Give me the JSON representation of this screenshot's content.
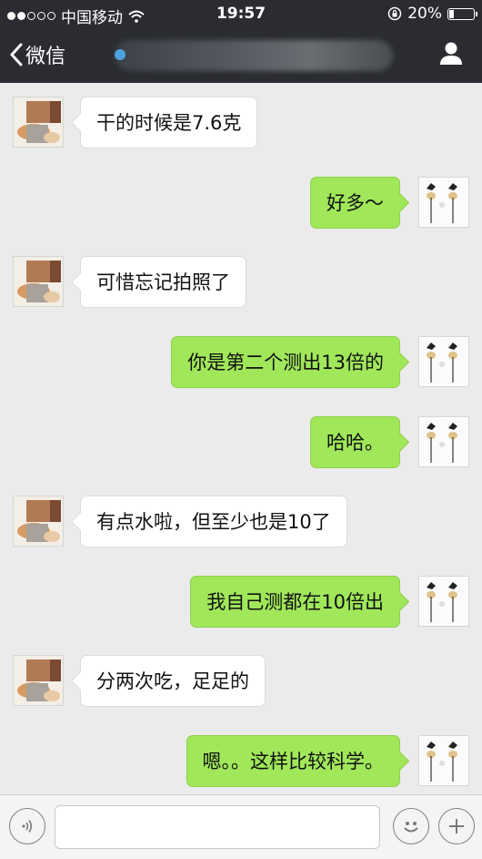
{
  "status": {
    "carrier": "中国移动",
    "time": "19:57",
    "battery": "20%",
    "battery_level": 0.2
  },
  "header": {
    "back_label": "微信",
    "profile_icon": "person-icon"
  },
  "messages": [
    {
      "side": "left",
      "text": "干的时候是7.6克"
    },
    {
      "side": "right",
      "text": "好多～"
    },
    {
      "side": "left",
      "text": "可惜忘记拍照了"
    },
    {
      "side": "right",
      "text": "你是第二个测出13倍的"
    },
    {
      "side": "right",
      "text": "哈哈。"
    },
    {
      "side": "left",
      "text": "有点水啦，但至少也是10了"
    },
    {
      "side": "right",
      "text": "我自己测都在10倍出"
    },
    {
      "side": "left",
      "text": "分两次吃，足足的"
    },
    {
      "side": "right",
      "text": "嗯。。这样比较科学。"
    }
  ],
  "inputbar": {
    "voice_icon": "voice-icon",
    "emoji_icon": "emoji-icon",
    "add_icon": "plus-icon",
    "input_value": ""
  }
}
